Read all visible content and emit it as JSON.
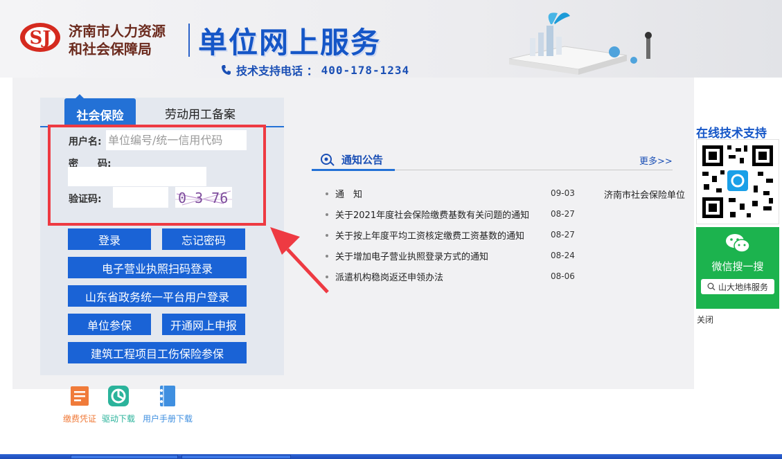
{
  "header": {
    "org_line1": "济南市人力资源",
    "org_line2": "和社会保障局",
    "service_title": "单位网上服务",
    "hotline_label": "技术支持电话 ：",
    "hotline_number": "400-178-1234"
  },
  "login": {
    "tab_active": "社会保险",
    "tab_inactive": "劳动用工备案",
    "username_label": "用户名:",
    "username_placeholder": "单位编号/统一信用代码",
    "password_label": "密　　码:",
    "captcha_label": "验证码:",
    "captcha_text": "0 3 76",
    "buttons": {
      "login": "登录",
      "forgot": "忘记密码",
      "license_scan": "电子营业执照扫码登录",
      "gov_login": "山东省政务统一平台用户登录",
      "unit_insure": "单位参保",
      "open_online": "开通网上申报",
      "construction": "建筑工程项目工伤保险参保"
    }
  },
  "bottom_icons": [
    {
      "label": "缴费凭证",
      "color": "#f07b3a"
    },
    {
      "label": "驱动下载",
      "color": "#2bb39b"
    },
    {
      "label": "用户手册下载",
      "color": "#3f8fe0"
    }
  ],
  "notice": {
    "title": "通知公告",
    "more": "更多>>",
    "items": [
      {
        "text": "通　知",
        "date": "09-03"
      },
      {
        "text": "关于2021年度社会保险缴费基数有关问题的通知",
        "date": "08-27"
      },
      {
        "text": "关于按上年度平均工资核定缴费工资基数的通知",
        "date": "08-27"
      },
      {
        "text": "关于增加电子营业执照登录方式的通知",
        "date": "08-24"
      },
      {
        "text": "派遣机构稳岗返还申领办法",
        "date": "08-06"
      }
    ],
    "extra_item": "济南市社会保险单位"
  },
  "support": {
    "title": "在线技术支持",
    "wechat_text": "微信搜一搜",
    "wechat_search": "山大地纬服务",
    "close": "关闭"
  },
  "colors": {
    "brand_blue": "#1a63d6",
    "highlight_red": "#ee3a42",
    "wechat_green": "#1cb34e"
  }
}
